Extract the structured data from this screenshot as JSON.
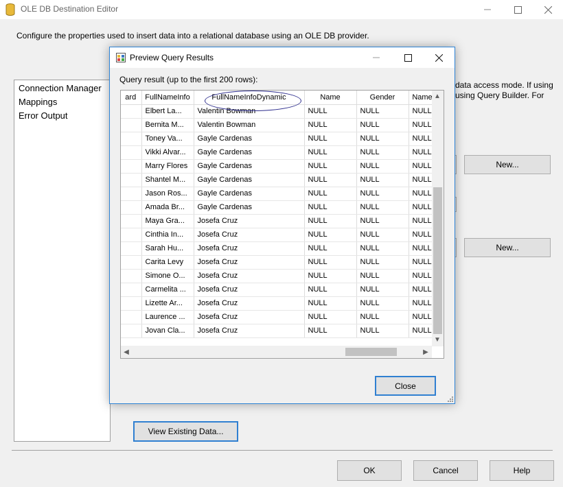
{
  "main_window": {
    "title": "OLE DB Destination Editor",
    "description": "Configure the properties used to insert data into a relational database using an OLE DB provider.",
    "nav_items": [
      "Connection Manager",
      "Mappings",
      "Error Output"
    ],
    "right_text_line1": "data access mode. If using",
    "right_text_line2": "using Query Builder. For",
    "new_button_1": "New...",
    "new_button_2": "New...",
    "view_existing_data": "View Existing Data...",
    "ok": "OK",
    "cancel": "Cancel",
    "help": "Help"
  },
  "dialog": {
    "title": "Preview Query Results",
    "grid_label": "Query result (up to the first 200 rows):",
    "close_button": "Close",
    "columns": [
      "ard",
      "FullNameInfo",
      "FullNameInfoDynamic",
      "Name",
      "Gender",
      "Name"
    ],
    "rows": [
      [
        "",
        "Elbert La...",
        "Valentin Bowman",
        "NULL",
        "NULL",
        "NULL"
      ],
      [
        "",
        "Bernita M...",
        "Valentin Bowman",
        "NULL",
        "NULL",
        "NULL"
      ],
      [
        "",
        "Toney Va...",
        "Gayle Cardenas",
        "NULL",
        "NULL",
        "NULL"
      ],
      [
        "",
        "Vikki Alvar...",
        "Gayle Cardenas",
        "NULL",
        "NULL",
        "NULL"
      ],
      [
        "",
        "Marry Flores",
        "Gayle Cardenas",
        "NULL",
        "NULL",
        "NULL"
      ],
      [
        "",
        "Shantel M...",
        "Gayle Cardenas",
        "NULL",
        "NULL",
        "NULL"
      ],
      [
        "",
        "Jason Ros...",
        "Gayle Cardenas",
        "NULL",
        "NULL",
        "NULL"
      ],
      [
        "",
        "Amada Br...",
        "Gayle Cardenas",
        "NULL",
        "NULL",
        "NULL"
      ],
      [
        "",
        "Maya Gra...",
        "Josefa Cruz",
        "NULL",
        "NULL",
        "NULL"
      ],
      [
        "",
        "Cinthia In...",
        "Josefa Cruz",
        "NULL",
        "NULL",
        "NULL"
      ],
      [
        "",
        "Sarah Hu...",
        "Josefa Cruz",
        "NULL",
        "NULL",
        "NULL"
      ],
      [
        "",
        "Carita Levy",
        "Josefa Cruz",
        "NULL",
        "NULL",
        "NULL"
      ],
      [
        "",
        "Simone O...",
        "Josefa Cruz",
        "NULL",
        "NULL",
        "NULL"
      ],
      [
        "",
        "Carmelita ...",
        "Josefa Cruz",
        "NULL",
        "NULL",
        "NULL"
      ],
      [
        "",
        "Lizette Ar...",
        "Josefa Cruz",
        "NULL",
        "NULL",
        "NULL"
      ],
      [
        "",
        "Laurence ...",
        "Josefa Cruz",
        "NULL",
        "NULL",
        "NULL"
      ],
      [
        "",
        "Jovan Cla...",
        "Josefa Cruz",
        "NULL",
        "NULL",
        "NULL"
      ]
    ]
  },
  "colors": {
    "accent_border": "#2d83d6",
    "annotation_oval": "#2c2c8c",
    "window_bg": "#f0f0f0"
  }
}
